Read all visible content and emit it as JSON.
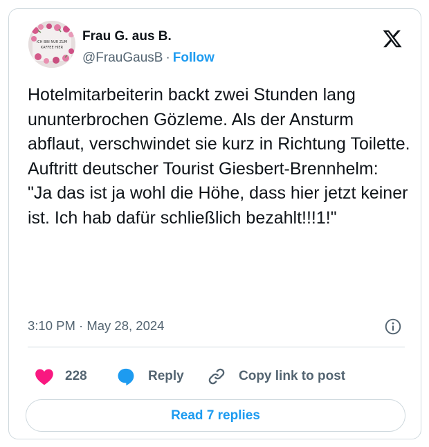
{
  "author": {
    "name": "Frau G. aus B.",
    "handle": "@FrauGausB",
    "separator": "·",
    "follow_label": "Follow",
    "avatar_caption_line1": "ICH BIN NUR ZUM",
    "avatar_caption_line2": "KAFFEE HIER"
  },
  "post": {
    "text": "Hotelmitarbeiterin backt zwei Stunden lang ununterbrochen Gözleme. Als der Ansturm abflaut, verschwindet sie kurz in Richtung Toilette.\nAuftritt deutscher Tourist Giesbert-Brennhelm:\n\"Ja das ist ja wohl die Höhe, dass hier jetzt keiner ist. Ich hab dafür schließlich bezahlt!!!1!\"",
    "timestamp": "3:10 PM · May 28, 2024"
  },
  "actions": {
    "likes": "228",
    "reply_label": "Reply",
    "copy_label": "Copy link to post"
  },
  "read_replies_label": "Read 7 replies",
  "icons": {
    "brand": "x-logo-icon",
    "info": "info-icon",
    "like": "heart-icon",
    "reply": "reply-bubble-icon",
    "copy": "link-icon"
  },
  "colors": {
    "accent": "#1d9bf0",
    "like": "#f91880",
    "text": "#0f1419",
    "muted": "#536471",
    "border": "#cfd9de"
  }
}
